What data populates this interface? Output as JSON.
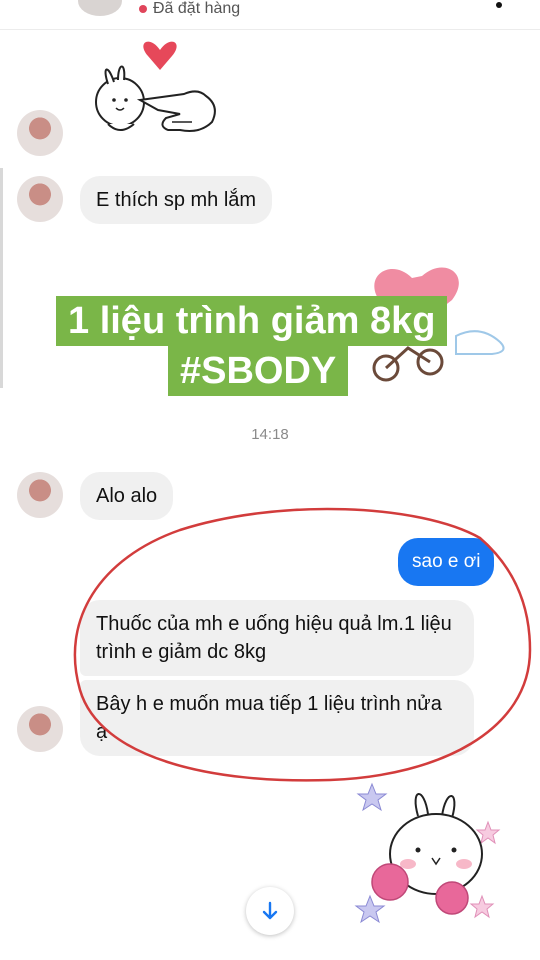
{
  "header": {
    "status_text": "Đã đặt hàng",
    "status_color": "#e0455b"
  },
  "messages": [
    {
      "sender": "contact",
      "type": "sticker",
      "sticker": "bunny-poke-heart-sticker"
    },
    {
      "sender": "contact",
      "type": "text",
      "text": "E thích sp mh lắm"
    },
    {
      "sender": "overlay",
      "type": "banner",
      "lines": [
        "1 liệu trình giảm 8kg",
        "#SBODY"
      ],
      "color": "#7ab648"
    },
    {
      "sender": "system",
      "type": "timestamp",
      "text": "14:18"
    },
    {
      "sender": "contact",
      "type": "text",
      "text": "Alo alo"
    },
    {
      "sender": "me",
      "type": "text",
      "text": "sao e ơi"
    },
    {
      "sender": "contact",
      "type": "text",
      "text": "Thuốc của mh e uống hiệu quả lm.1 liệu trình e giảm dc 8kg"
    },
    {
      "sender": "contact",
      "type": "text",
      "text": "Bây h e muốn mua tiếp 1 liệu trình nửa ạ"
    },
    {
      "sender": "contact",
      "type": "sticker",
      "sticker": "bunny-pompom-sticker"
    }
  ],
  "colors": {
    "outgoing_bubble": "#1877f2",
    "incoming_bubble": "#f0f0f0",
    "annotation_circle": "#d23c3c"
  },
  "scroll_button": {
    "icon": "arrow-down-icon"
  }
}
